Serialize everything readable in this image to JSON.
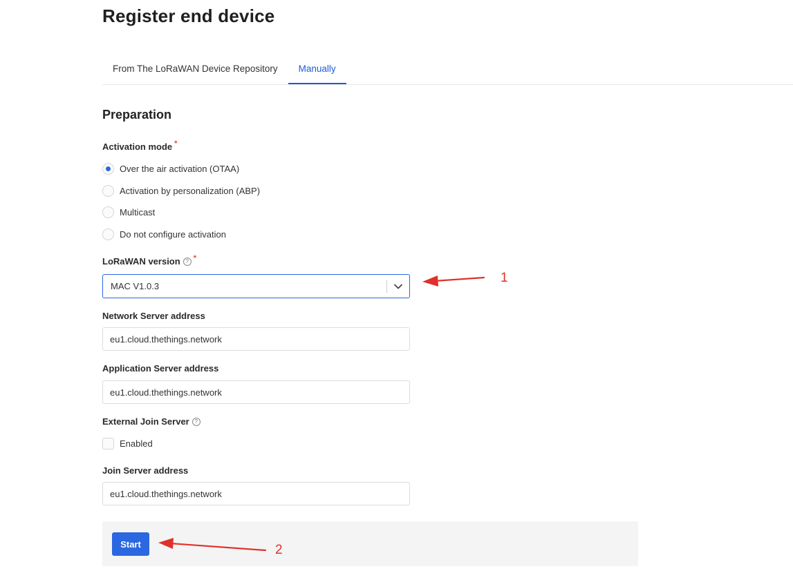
{
  "page": {
    "title": "Register end device"
  },
  "tabs": [
    {
      "label": "From The LoRaWAN Device Repository",
      "active": false
    },
    {
      "label": "Manually",
      "active": true
    }
  ],
  "section": {
    "title": "Preparation"
  },
  "activation_mode": {
    "label": "Activation mode",
    "required_mark": "*",
    "options": [
      {
        "label": "Over the air activation (OTAA)",
        "checked": true
      },
      {
        "label": "Activation by personalization (ABP)",
        "checked": false
      },
      {
        "label": "Multicast",
        "checked": false
      },
      {
        "label": "Do not configure activation",
        "checked": false
      }
    ]
  },
  "lorawan_version": {
    "label": "LoRaWAN version",
    "help_icon": "help-circle-icon",
    "required_mark": "*",
    "value": "MAC V1.0.3"
  },
  "network_server": {
    "label": "Network Server address",
    "value": "eu1.cloud.thethings.network"
  },
  "application_server": {
    "label": "Application Server address",
    "value": "eu1.cloud.thethings.network"
  },
  "external_join_server": {
    "label": "External Join Server",
    "help_icon": "help-circle-icon",
    "checkbox_label": "Enabled",
    "checked": false
  },
  "join_server": {
    "label": "Join Server address",
    "value": "eu1.cloud.thethings.network"
  },
  "actions": {
    "start_label": "Start"
  },
  "annotations": {
    "arrow_1_number": "1",
    "arrow_2_number": "2",
    "color": "#e0302b"
  },
  "colors": {
    "accent": "#2a67e0",
    "tab_active": "#1a5bdc",
    "required": "#e24b3b",
    "footer_bg": "#f4f4f4"
  }
}
